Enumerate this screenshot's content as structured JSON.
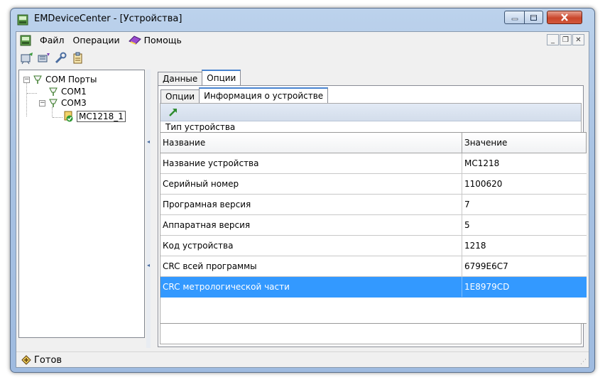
{
  "window": {
    "title": "EMDeviceCenter - [Устройства]"
  },
  "menu": {
    "items": [
      "Файл",
      "Операции",
      "Помощь"
    ]
  },
  "tree": {
    "root": "COM Порты",
    "ports": [
      "COM1",
      "COM3"
    ],
    "device": "MC1218_1"
  },
  "tabs_outer": [
    "Данные",
    "Опции"
  ],
  "tabs_inner": [
    "Опции",
    "Информация о устройстве"
  ],
  "group_label": "Тип устройства",
  "grid": {
    "headers": [
      "Название",
      "Значение"
    ],
    "rows": [
      [
        "Название устройства",
        "MC1218"
      ],
      [
        "Серийный номер",
        "1100620"
      ],
      [
        "Програмная версия",
        "7"
      ],
      [
        "Аппаратная версия",
        "5"
      ],
      [
        "Код устройства",
        "1218"
      ],
      [
        "CRC всей программы",
        "6799E6C7"
      ],
      [
        "CRC метрологической части",
        "1E8979CD"
      ]
    ],
    "selected_row": 6
  },
  "status": {
    "text": "Готов"
  },
  "colors": {
    "selection": "#3399ff",
    "tab_accent": "#4783d0",
    "close_button": "#c9462c"
  }
}
